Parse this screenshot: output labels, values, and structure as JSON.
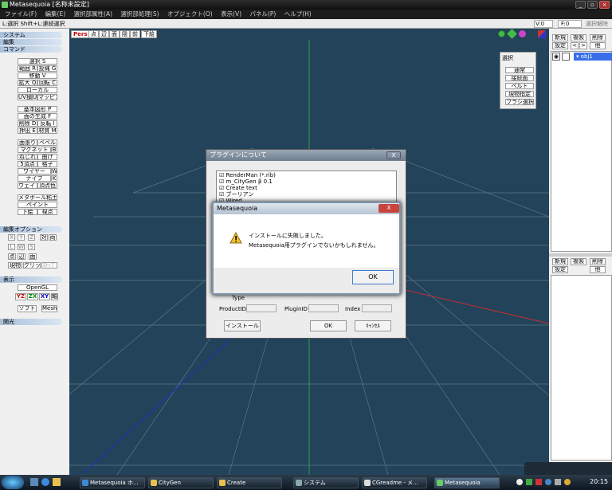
{
  "window": {
    "title": "Metasequoia [名称未設定]"
  },
  "menu": [
    "ファイル(F)",
    "編集(E)",
    "選択部属性(A)",
    "選択部処理(S)",
    "オブジェクト(O)",
    "表示(V)",
    "パネル(P)",
    "ヘルプ(H)"
  ],
  "status": {
    "hint": "L:選択  Shift+L:連続選択",
    "v": "V:0",
    "f": "F:0",
    "mode": "選択解除"
  },
  "left": {
    "sections": [
      "システム",
      "編集",
      "コマンド",
      "編集オプション",
      "表示",
      "関光"
    ],
    "cmd": [
      "選択 S",
      "範囲 R",
      "投縄 G",
      "移動 V",
      "拡大 Q",
      "回転 C",
      "ローカル",
      "UV操作",
      "U",
      "マッピング",
      "基本図形 P",
      "面の生成 F",
      "削除 D",
      "反転 I",
      "押出 E",
      "材質 M",
      "面張り",
      "ベベル",
      "マグネット",
      "B",
      "ねじれ",
      "曲げ",
      "5頂点",
      "格子",
      "ワイヤー",
      "W",
      "ナイフ",
      "K",
      "ウェイト",
      "頂点色",
      "メタボール粘土",
      "ペイント",
      "下絵",
      "視点"
    ],
    "opt": [
      "X",
      "Y",
      "Z",
      "対",
      "両",
      "L",
      "W",
      "S",
      "点",
      "辺",
      "面",
      "現物",
      "グリッド",
      "ｽﾅｯﾌﾟ"
    ],
    "disp": [
      "OpenGL",
      "YZ",
      "ZX",
      "XY",
      "軸",
      "ソフト",
      "Mesh"
    ]
  },
  "viewport": {
    "tools": [
      "Pers",
      "点",
      "辺",
      "面",
      "隠",
      "前",
      "下絵"
    ]
  },
  "select_panel": {
    "title": "選択",
    "items": [
      "通常",
      "接続面",
      "ベルト",
      "現物指定",
      "ブラシ選択"
    ]
  },
  "right": {
    "top_buttons": [
      "新規",
      "複製",
      "削除",
      "設定",
      "<",
      ">",
      "他"
    ],
    "object": "obj1",
    "bottom_buttons": [
      "新規",
      "複製",
      "削除",
      "設定",
      "他"
    ]
  },
  "plugin_dialog": {
    "title": "プラグインについて",
    "plugins": [
      "RenderMan (*.rib)",
      "m_CityGen β 0.1",
      "Create text",
      "ブーリアン",
      "Wired"
    ],
    "fields": [
      "Type",
      "ProductID",
      "PluginID",
      "Index"
    ],
    "install": "インストール",
    "ok": "OK",
    "cancel": "ｷｬﾝｾﾙ",
    "close": "X"
  },
  "alert": {
    "title": "Metasequoia",
    "line1": "インストールに失敗しました。",
    "line2": "Metasequoia用プラグインでないかもしれません。",
    "ok": "OK",
    "close": "X"
  },
  "taskbar": {
    "tasks": [
      "Metasequoia ホ...",
      "CityGen",
      "Create",
      "システム",
      "CGreadme - メ...",
      "Metasequoia"
    ],
    "clock": "20:15"
  },
  "colors": {
    "viewport": "#23435a",
    "grid": "#5f7585",
    "axis_x": "#c03030",
    "axis_y": "#2fa040",
    "axis_z": "#2030c0"
  }
}
